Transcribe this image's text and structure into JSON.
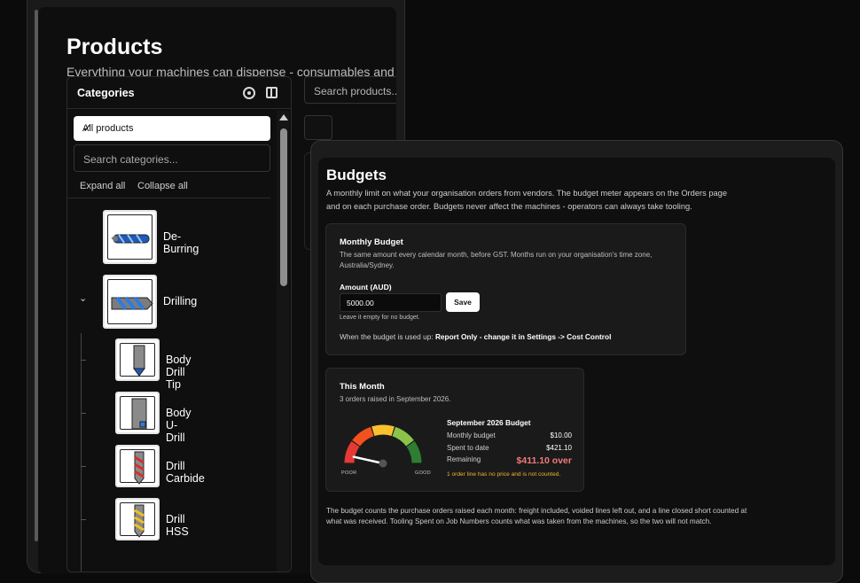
{
  "products": {
    "title": "Products",
    "subtitle": "Everything your machines can dispense - consumables and t",
    "search_placeholder": "Search products...",
    "categories": {
      "title": "Categories",
      "all_products": "All products",
      "check": "✓",
      "search_placeholder": "Search categories...",
      "expand_all": "Expand all",
      "collapse_all": "Collapse all",
      "chevron": "⌄",
      "items": [
        {
          "label": "De-Burring"
        },
        {
          "label": "Drilling"
        },
        {
          "label": "Body Drill Tip"
        },
        {
          "label": "Body U-Drill"
        },
        {
          "label": "Drill Carbide"
        },
        {
          "label": "Drill HSS"
        }
      ]
    }
  },
  "budgets": {
    "title": "Budgets",
    "description": "A monthly limit on what your organisation orders from vendors. The budget meter appears on the Orders page and on each purchase order. Budgets never affect the machines - operators can always take tooling.",
    "monthly": {
      "title": "Monthly Budget",
      "description": "The same amount every calendar month, before GST. Months run on your organisation's time zone, Australia/Sydney.",
      "amount_label": "Amount (AUD)",
      "amount_value": "5000.00",
      "save_label": "Save",
      "hint": "Leave it empty for no budget.",
      "used_prefix": "When the budget is used up: ",
      "used_mode": "Report Only",
      "used_suffix": " - change it in Settings -> Cost Control"
    },
    "this_month": {
      "title": "This Month",
      "subtitle": "3 orders raised in September 2026.",
      "gauge_poor": "POOR",
      "gauge_good": "GOOD",
      "gauge_level": 0.07,
      "summary_title": "September 2026 Budget",
      "monthly_budget_label": "Monthly budget",
      "monthly_budget_value": "$10.00",
      "spent_label": "Spent to date",
      "spent_value": "$421.10",
      "remaining_label": "Remaining",
      "remaining_value": "$411.10 over",
      "warning": "1 order line has no price and is not counted."
    },
    "footnote": "The budget counts the purchase orders raised each month: freight included, voided lines left out, and a line closed short counted at what was received. Tooling Spent on Job Numbers counts what was taken from the machines, so the two will not match.",
    "colors": {
      "over": "#f47a7a",
      "warning": "#f1b431",
      "gauge": [
        "#e53935",
        "#f4511e",
        "#fbc02d",
        "#8bc34a",
        "#2e7d32"
      ]
    }
  }
}
